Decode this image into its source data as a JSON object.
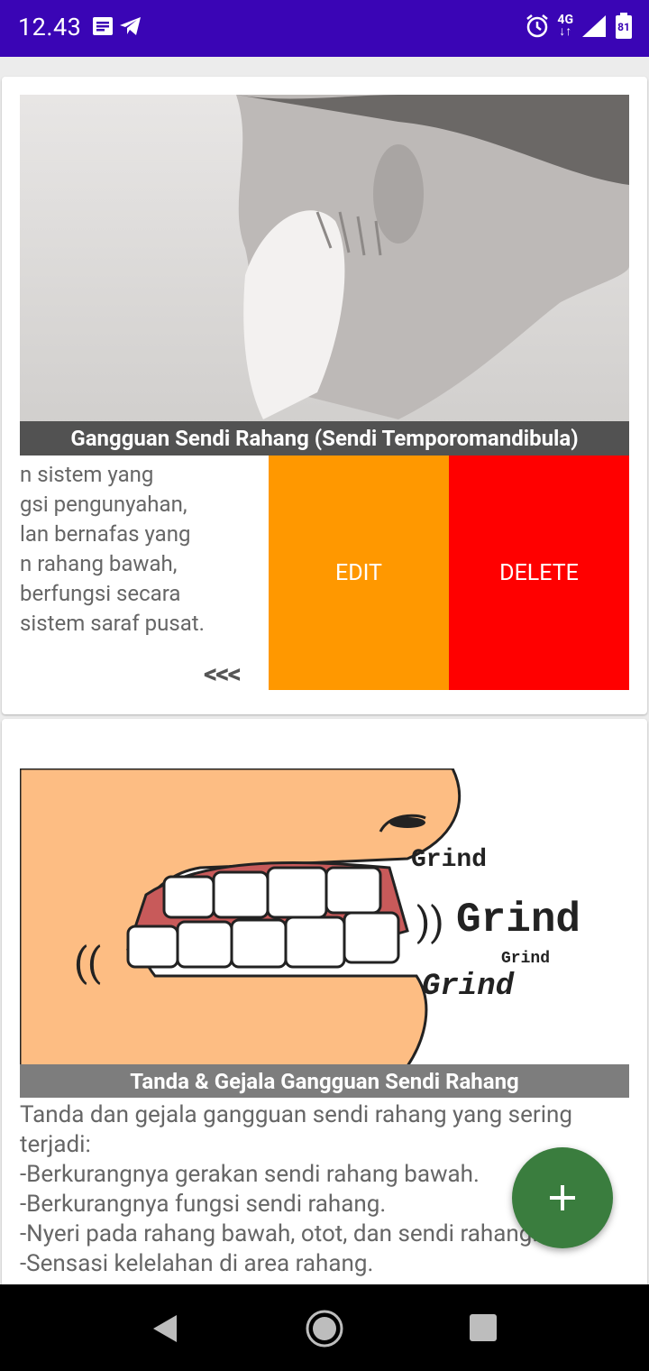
{
  "status_bar": {
    "time": "12.43",
    "network": "4G",
    "battery": "81",
    "icons": [
      "notes-icon",
      "telegram-icon",
      "alarm-icon",
      "network-arrows-icon",
      "signal-icon",
      "battery-icon"
    ]
  },
  "cards": [
    {
      "title": "Gangguan Sendi Rahang (Sendi Temporomandibula)",
      "description_lines": [
        "n sistem yang",
        "gsi pengunyahan,",
        "lan bernafas yang",
        "n rahang bawah,",
        " berfungsi secara",
        "sistem saraf pusat."
      ],
      "swipe_hint": "<<<",
      "edit_label": "EDIT",
      "delete_label": "DELETE"
    },
    {
      "title": "Tanda & Gejala Gangguan Sendi Rahang",
      "image_text": [
        "Grind",
        "Grind",
        "Grind",
        "Grind"
      ],
      "description_lines": [
        "Tanda dan gejala gangguan sendi rahang yang sering",
        "terjadi:",
        "-Berkurangnya gerakan sendi rahang bawah.",
        "-Berkurangnya fungsi sendi rahang.",
        "-Nyeri pada rahang bawah, otot, dan sendi rahang.",
        "-Sensasi kelelahan di area rahang."
      ]
    }
  ],
  "fab": {
    "icon": "plus-icon"
  },
  "colors": {
    "status_bar": "#3a05b5",
    "edit": "#ff9800",
    "delete": "#ff0000",
    "fab": "#3a7d3e"
  }
}
